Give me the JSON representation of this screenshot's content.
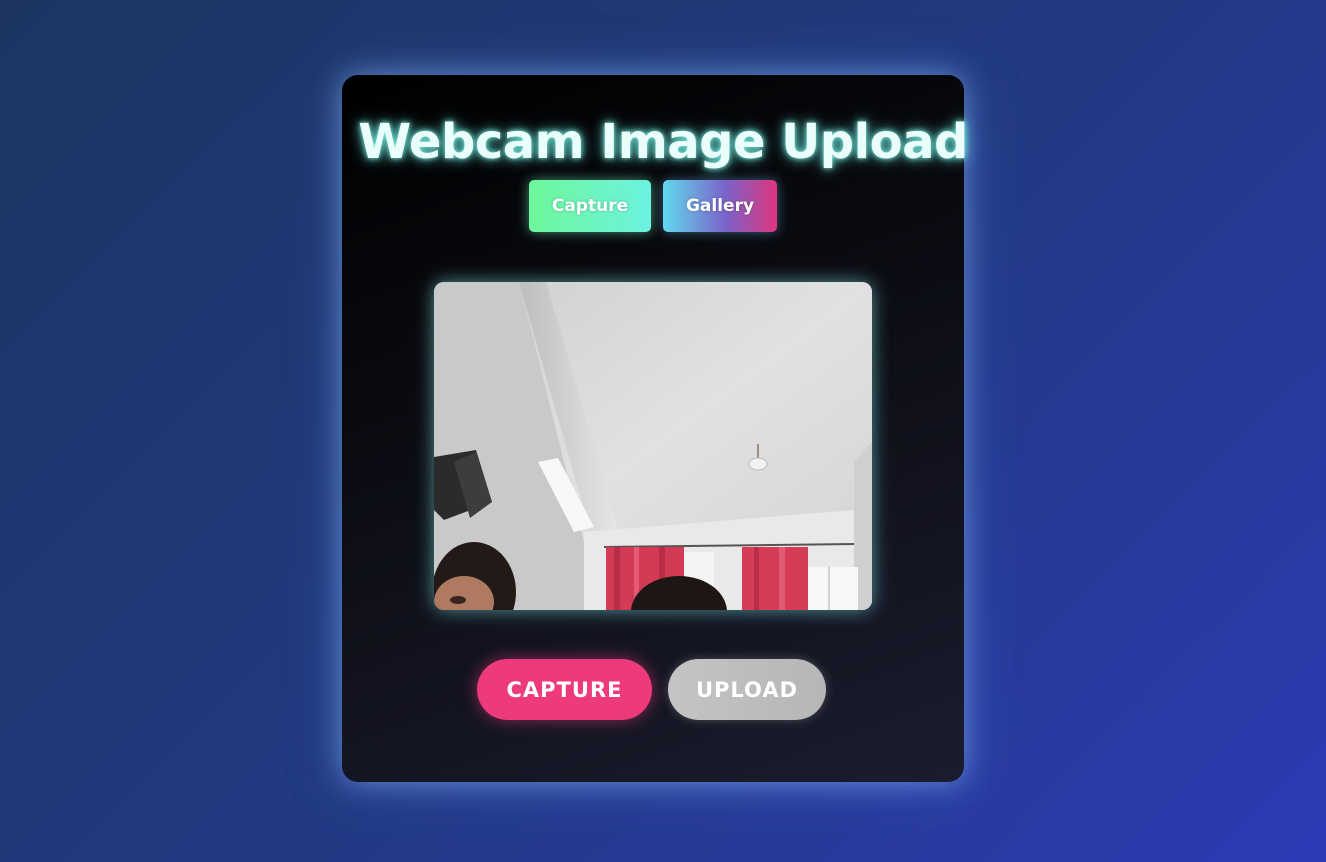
{
  "page": {
    "title": "Webcam Image Upload"
  },
  "mode_tabs": {
    "capture_label": "Capture",
    "gallery_label": "Gallery"
  },
  "actions": {
    "capture_label": "CAPTURE",
    "upload_label": "UPLOAD"
  },
  "colors": {
    "title_glow": "#7ff5e6",
    "capture_action": "#ec3a7b",
    "upload_action": "#c4c4c4"
  },
  "icons": {
    "preview": "webcam-feed"
  }
}
